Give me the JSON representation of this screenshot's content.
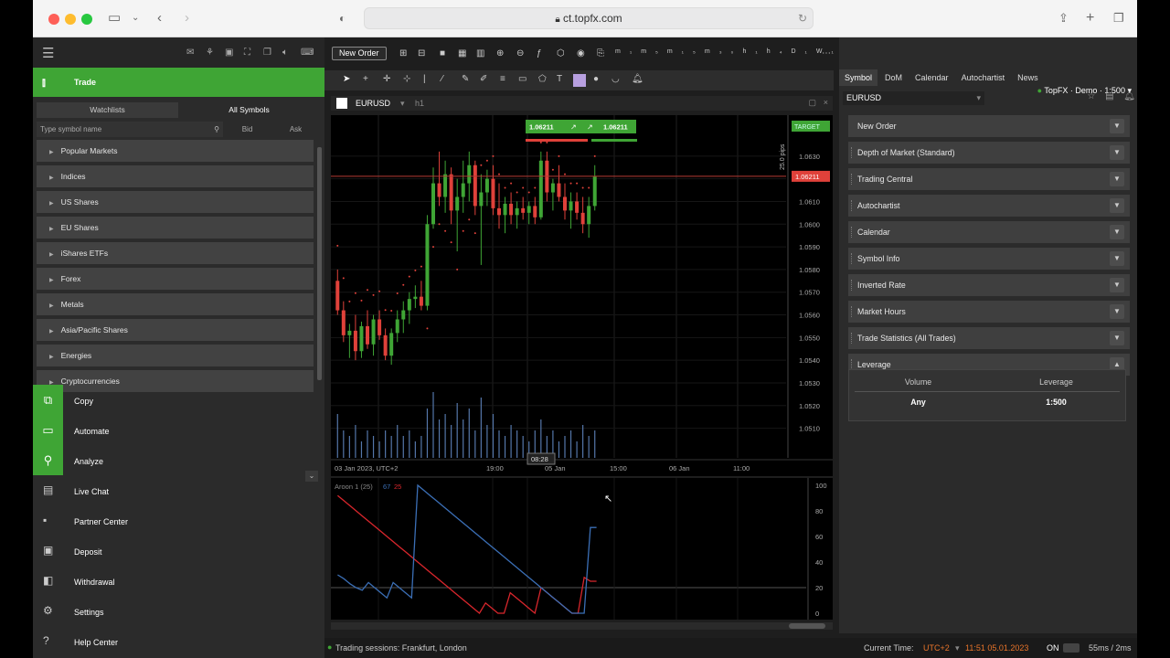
{
  "browser": {
    "url": "ct.topfx.com",
    "lock_icon": "lock-icon"
  },
  "account": {
    "label": "TopFX · Demo · 1:500"
  },
  "toolbar": {
    "new_order": "New Order"
  },
  "left_panel": {
    "trade_label": "Trade",
    "tabs": [
      "Watchlists",
      "All Symbols"
    ],
    "search_placeholder": "Type symbol name",
    "col_bid": "Bid",
    "col_ask": "Ask",
    "categories": [
      "Popular Markets",
      "Indices",
      "US Shares",
      "EU Shares",
      "iShares ETFs",
      "Forex",
      "Metals",
      "Asia/Pacific Shares",
      "Energies",
      "Cryptocurrencies"
    ],
    "nav": [
      {
        "label": "Copy",
        "icon": "copy-icon",
        "active": true
      },
      {
        "label": "Automate",
        "icon": "automate-icon",
        "active": true
      },
      {
        "label": "Analyze",
        "icon": "analyze-icon",
        "active": true
      },
      {
        "label": "Live Chat",
        "icon": "chat-icon",
        "active": false
      },
      {
        "label": "Partner Center",
        "icon": "partner-icon",
        "active": false
      },
      {
        "label": "Deposit",
        "icon": "deposit-icon",
        "active": false
      },
      {
        "label": "Withdrawal",
        "icon": "withdrawal-icon",
        "active": false
      },
      {
        "label": "Settings",
        "icon": "gear-icon",
        "active": false
      },
      {
        "label": "Help Center",
        "icon": "help-icon",
        "active": false
      }
    ]
  },
  "chart": {
    "symbol": "EURUSD",
    "timeframe": "h1",
    "sell_price": "1.06211",
    "buy_price": "1.06211",
    "current_price_tag": "1.06211",
    "target_tag": "TARGET",
    "pips_label": "25.0 pips",
    "price_axis": [
      "1.0630",
      "1.0620",
      "1.0610",
      "1.0600",
      "1.0590",
      "1.0580",
      "1.0570",
      "1.0560",
      "1.0550",
      "1.0540",
      "1.0530",
      "1.0520",
      "1.0510"
    ],
    "time_axis": [
      "03 Jan 2023, UTC+2",
      "19:00",
      "05 Jan",
      "15:00",
      "06 Jan",
      "11:00"
    ],
    "crosshair_time": "08:28",
    "oscillator_label": "Aroon 1 (25)",
    "osc_val_up": "67",
    "osc_val_down": "25",
    "osc_axis": [
      "100",
      "80",
      "60",
      "40",
      "20",
      "0"
    ]
  },
  "chart_data": {
    "type": "candlestick",
    "symbol": "EURUSD",
    "timeframe": "h1",
    "candles": [
      [
        1.0575,
        1.058,
        1.056,
        1.0562
      ],
      [
        1.0562,
        1.0566,
        1.0548,
        1.0551
      ],
      [
        1.0551,
        1.0556,
        1.0541,
        1.0553
      ],
      [
        1.0553,
        1.056,
        1.054,
        1.0544
      ],
      [
        1.0544,
        1.0557,
        1.0541,
        1.0555
      ],
      [
        1.0555,
        1.0562,
        1.0545,
        1.0547
      ],
      [
        1.0547,
        1.056,
        1.0542,
        1.0558
      ],
      [
        1.0558,
        1.0562,
        1.0549,
        1.0551
      ],
      [
        1.0551,
        1.0554,
        1.054,
        1.0542
      ],
      [
        1.0542,
        1.0554,
        1.0538,
        1.0552
      ],
      [
        1.0552,
        1.0562,
        1.0548,
        1.0558
      ],
      [
        1.0558,
        1.0566,
        1.0552,
        1.0562
      ],
      [
        1.0562,
        1.057,
        1.0556,
        1.0567
      ],
      [
        1.0567,
        1.0573,
        1.0563,
        1.0568
      ],
      [
        1.0568,
        1.0575,
        1.0562,
        1.0564
      ],
      [
        1.0564,
        1.0604,
        1.0562,
        1.06
      ],
      [
        1.06,
        1.0625,
        1.0598,
        1.0618
      ],
      [
        1.0618,
        1.0632,
        1.0608,
        1.0612
      ],
      [
        1.0612,
        1.0628,
        1.0605,
        1.0622
      ],
      [
        1.0622,
        1.0625,
        1.06,
        1.0606
      ],
      [
        1.0606,
        1.062,
        1.0588,
        1.0612
      ],
      [
        1.0612,
        1.0628,
        1.0605,
        1.0618
      ],
      [
        1.0618,
        1.0632,
        1.061,
        1.0626
      ],
      [
        1.0626,
        1.0628,
        1.0604,
        1.0608
      ],
      [
        1.0608,
        1.0622,
        1.0582,
        1.0614
      ],
      [
        1.0614,
        1.0624,
        1.0608,
        1.062
      ],
      [
        1.062,
        1.0626,
        1.0604,
        1.0607
      ],
      [
        1.0607,
        1.0618,
        1.0598,
        1.0604
      ],
      [
        1.0604,
        1.0612,
        1.0596,
        1.0609
      ],
      [
        1.0609,
        1.0614,
        1.06,
        1.0604
      ],
      [
        1.0604,
        1.061,
        1.0598,
        1.0607
      ],
      [
        1.0607,
        1.0612,
        1.0602,
        1.0605
      ],
      [
        1.0605,
        1.061,
        1.06,
        1.0608
      ],
      [
        1.0608,
        1.0612,
        1.06,
        1.0603
      ],
      [
        1.0603,
        1.0632,
        1.0602,
        1.0628
      ],
      [
        1.0628,
        1.0632,
        1.061,
        1.0614
      ],
      [
        1.0614,
        1.062,
        1.0606,
        1.0618
      ],
      [
        1.0618,
        1.0626,
        1.061,
        1.0612
      ],
      [
        1.0612,
        1.0618,
        1.0602,
        1.0606
      ],
      [
        1.0606,
        1.0614,
        1.0598,
        1.061
      ],
      [
        1.061,
        1.0614,
        1.0602,
        1.0605
      ],
      [
        1.0605,
        1.0612,
        1.0596,
        1.06
      ],
      [
        1.06,
        1.0612,
        1.0594,
        1.0608
      ],
      [
        1.0608,
        1.0626,
        1.0606,
        1.0621
      ]
    ],
    "volume": [
      8,
      5,
      4,
      6,
      3,
      5,
      4,
      3,
      5,
      4,
      6,
      4,
      5,
      3,
      4,
      9,
      12,
      7,
      8,
      6,
      10,
      7,
      9,
      5,
      11,
      6,
      8,
      5,
      4,
      6,
      5,
      4,
      3,
      5,
      7,
      4,
      5,
      3,
      4,
      5,
      3,
      6,
      4,
      5
    ],
    "aroon_up": [
      30,
      27,
      23,
      20,
      18,
      24,
      20,
      16,
      12,
      24,
      20,
      16,
      12,
      100,
      96,
      92,
      88,
      84,
      80,
      76,
      72,
      68,
      64,
      60,
      56,
      52,
      48,
      44,
      40,
      36,
      32,
      28,
      24,
      20,
      16,
      12,
      8,
      4,
      0,
      0,
      0,
      67,
      67
    ],
    "aroon_down": [
      92,
      88,
      84,
      80,
      76,
      72,
      68,
      64,
      60,
      56,
      52,
      48,
      44,
      40,
      36,
      32,
      28,
      24,
      20,
      16,
      12,
      8,
      4,
      0,
      8,
      4,
      0,
      0,
      16,
      12,
      8,
      4,
      0,
      20,
      16,
      12,
      8,
      4,
      0,
      0,
      28,
      25,
      25
    ],
    "ylim": [
      1.0505,
      1.064
    ],
    "osc_ylim": [
      0,
      100
    ]
  },
  "right_panel": {
    "tabs": [
      "Symbol",
      "DoM",
      "Calendar",
      "Autochartist",
      "News"
    ],
    "symbol": "EURUSD",
    "sections": [
      "New Order",
      "Depth of Market (Standard)",
      "Trading Central",
      "Autochartist",
      "Calendar",
      "Symbol Info",
      "Inverted Rate",
      "Market Hours",
      "Trade Statistics (All Trades)",
      "Leverage"
    ],
    "leverage": {
      "col_volume": "Volume",
      "col_leverage": "Leverage",
      "volume": "Any",
      "leverage": "1:500"
    }
  },
  "status": {
    "sessions": "Trading sessions: Frankfurt, London",
    "current_time_label": "Current Time:",
    "tz": "UTC+2",
    "time": "11:51 05.01.2023",
    "on": "ON",
    "latency": "55ms / 2ms"
  },
  "colors": {
    "accent": "#3fa535",
    "bull": "#3fa535",
    "bear": "#e0413a",
    "aroon_up": "#3b6fb6",
    "aroon_down": "#d9262c"
  }
}
